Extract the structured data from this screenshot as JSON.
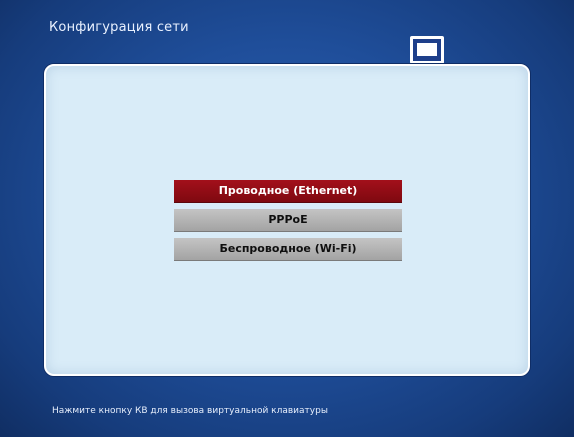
{
  "header": {
    "title": "Конфигурация сети",
    "icon": "network-computer-icon"
  },
  "menu": {
    "items": [
      {
        "label": "Проводное (Ethernet)",
        "selected": true
      },
      {
        "label": "PPPoE",
        "selected": false
      },
      {
        "label": "Беспроводное (Wi-Fi)",
        "selected": false
      }
    ]
  },
  "footer": {
    "hint": "Нажмите кнопку КВ для вызова виртуальной клавиатуры"
  },
  "colors": {
    "background": "#1f4e9a",
    "panel": "#d9ecf8",
    "selected_item": "#8e0d15",
    "normal_item": "#b3b3b3"
  }
}
